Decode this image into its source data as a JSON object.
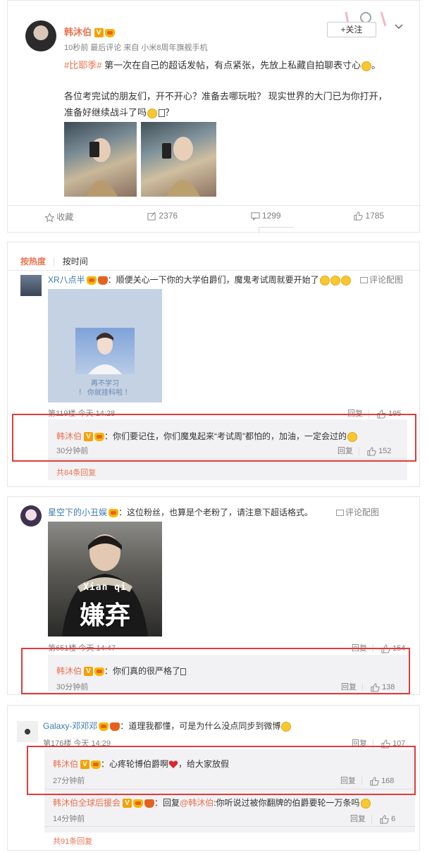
{
  "post": {
    "author": "韩沐伯",
    "meta": "10秒前 最后评论 来自 小米8周年旗舰手机",
    "follow_label": "+关注",
    "hashtag": "#比耶季#",
    "text1": " 第一次在自己的超话发帖，有点紧张，先放上私藏自拍聊表寸心",
    "text2_line1": "各位考完试的朋友们，开不开心？准备去哪玩啦？  现实世界的大门已为你打开，",
    "text2_line2": "准备好继续战斗了吗",
    "text2_tail": "？",
    "actions": {
      "fav": "收藏",
      "repost": "2376",
      "comment": "1299",
      "like": "1785"
    }
  },
  "sort": {
    "hot": "按热度",
    "time": "按时间"
  },
  "comments": [
    {
      "user": "XR八点半",
      "text": "：顺便关心一下你的大学伯爵们，魔鬼考试周就要开始了",
      "pic_link": "评论配图",
      "pic_caption_1": "再不学习",
      "pic_caption_2": "！ 你就挂科啦 ！",
      "floor": "第119楼  今天 14:28",
      "reply": "回复",
      "likes": "195",
      "sub": {
        "user": "韩沐伯",
        "text": "：你们要记住，你们魔鬼起来“考试周”都怕的，加油，一定会过的",
        "time": "30分钟前",
        "reply": "回复",
        "likes": "152"
      },
      "more": "共84条回复"
    },
    {
      "user": "星空下的小丑娱",
      "text": "：这位粉丝，也算是个老粉了，请注意下超话格式。",
      "pic_link": "评论配图",
      "pic_caption_1": "Xian qi",
      "pic_caption_2": "嫌弃",
      "floor": "第651楼  今天 14:47",
      "reply": "回复",
      "likes": "154",
      "sub": {
        "user": "韩沐伯",
        "text": "：你们真的很严格了",
        "time": "30分钟前",
        "reply": "回复",
        "likes": "138"
      }
    },
    {
      "user": "Galaxy-邓邓邓",
      "text": "：道理我都懂，可是为什么没点同步到微博",
      "floor": "第176楼  今天 14:29",
      "reply": "回复",
      "likes": "107",
      "sub": {
        "user": "韩沐伯",
        "text": "：心疼轮博伯爵啊",
        "text_tail": "，给大家放假",
        "time": "27分钟前",
        "reply": "回复",
        "likes": "168"
      },
      "sub2": {
        "user": "韩沐伯全球后援会",
        "text_pre": "：回复",
        "mention": "@韩沐伯",
        "text": ":你听说过被你翻牌的伯爵要轮一万条吗",
        "time": "14分钟前",
        "reply": "回复",
        "likes": "6"
      },
      "more": "共91条回复"
    }
  ],
  "colors": {
    "accent": "#eb7350",
    "link": "#3b7ab5",
    "highlight": "#e23b3b"
  }
}
